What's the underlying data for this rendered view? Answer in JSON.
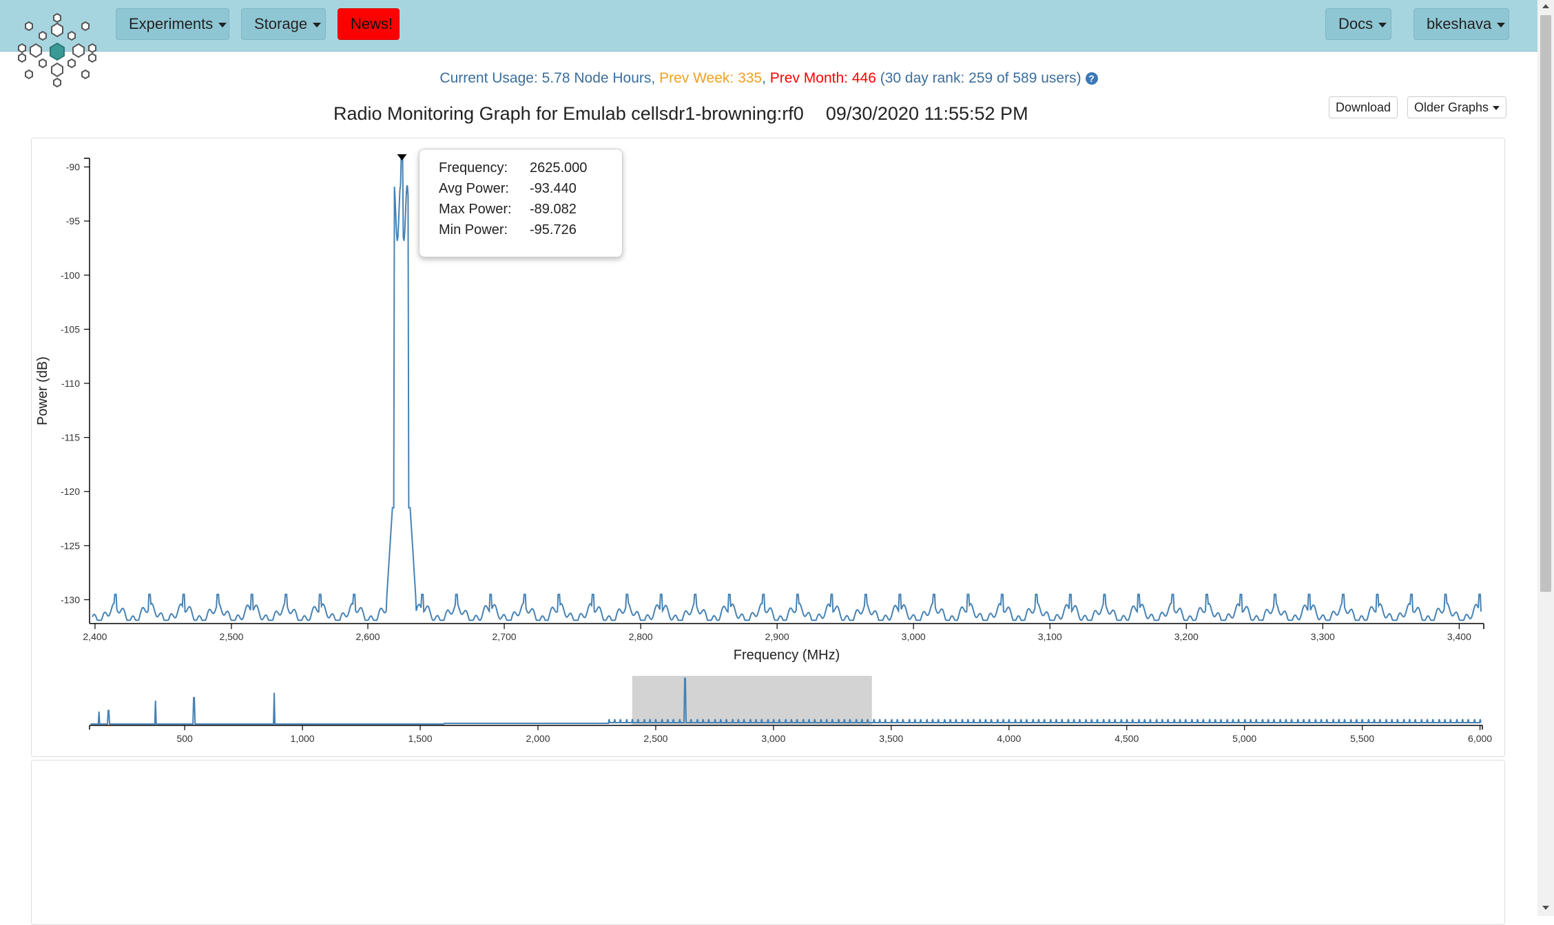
{
  "nav": {
    "experiments": "Experiments",
    "storage": "Storage",
    "news": "News!",
    "docs": "Docs",
    "user": "bkeshava"
  },
  "usage": {
    "current_label": "Current Usage: ",
    "current_value": "5.78 Node Hours",
    "week_label": "Prev Week: ",
    "week_value": "335",
    "month_label": "Prev Month: ",
    "month_value": "446",
    "rank": "(30 day rank: 259 of 589 users)",
    "help_icon": "question-circle-icon"
  },
  "page": {
    "title": "Radio Monitoring Graph for Emulab cellsdr1-browning:rf0",
    "timestamp": "09/30/2020 11:55:52 PM",
    "download": "Download",
    "older": "Older Graphs"
  },
  "tooltip": {
    "freq_label": "Frequency:",
    "freq_value": "2625.000",
    "avg_label": "Avg Power:",
    "avg_value": "-93.440",
    "max_label": "Max Power:",
    "max_value": "-89.082",
    "min_label": "Min Power:",
    "min_value": "-95.726"
  },
  "chart_data": [
    {
      "type": "line",
      "xlabel": "Frequency (MHz)",
      "ylabel": "Power (dB)",
      "xlim": [
        2396,
        3418
      ],
      "ylim": [
        -132.2,
        -89.2
      ],
      "x_ticks": [
        2400,
        2500,
        2600,
        2700,
        2800,
        2900,
        3000,
        3100,
        3200,
        3300,
        3400
      ],
      "y_ticks": [
        -90,
        -95,
        -100,
        -105,
        -110,
        -115,
        -120,
        -125,
        -130
      ],
      "series": [
        {
          "color": "#4682b4",
          "baseline_db": -131.3,
          "ripple_db": 0.6,
          "spike_spacing_mhz": 25,
          "spike_first_mhz": 2415,
          "spike_peak_db": -129.5,
          "signal": {
            "center_mhz": 2625,
            "start_mhz": 2618,
            "end_mhz": 2631,
            "peak_db": -89.082,
            "avg_db": -93.44,
            "min_db": -95.726,
            "skirt_db": -121.5
          }
        }
      ],
      "marker": {
        "x": 2625,
        "y": -89.082
      }
    },
    {
      "type": "line",
      "role": "overview-brush",
      "xlim": [
        96,
        6010
      ],
      "x_ticks": [
        500,
        1000,
        1500,
        2000,
        2500,
        3000,
        3500,
        4000,
        4500,
        5000,
        5500,
        6000
      ],
      "brush": [
        2400,
        3418
      ],
      "peaks": [
        [
          136,
          0.28
        ],
        [
          176,
          0.3
        ],
        [
          376,
          0.5
        ],
        [
          540,
          0.56
        ],
        [
          880,
          0.66
        ],
        [
          2625,
          0.95
        ]
      ],
      "ripple_start_mhz": 2300,
      "ripple_spacing_mhz": 25
    }
  ],
  "colors": {
    "navbar": "#a6d5e0",
    "series": "#4682b4",
    "news": "#ff0000",
    "usage_text": "#3a6e9c",
    "week": "#f0a020",
    "month": "#ff0000"
  }
}
